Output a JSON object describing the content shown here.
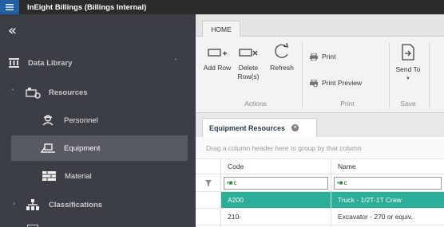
{
  "app": {
    "title": "InEight Billings  (Billings Internal)",
    "colors": {
      "titlebar": "#2b2b2b",
      "menu_button": "#1e5fa6",
      "sidebar": "#3b3e45",
      "selected_row": "#2bae98"
    }
  },
  "sidebar": {
    "collapse_icon": "double-chevron-left-icon",
    "items": [
      {
        "label": "Data Library",
        "icon": "library-icon",
        "expanded": true
      },
      {
        "label": "Resources",
        "icon": "resources-icon",
        "expanded": true
      },
      {
        "label": "Personnel",
        "icon": "personnel-icon"
      },
      {
        "label": "Equipment",
        "icon": "equipment-icon",
        "selected": true
      },
      {
        "label": "Material",
        "icon": "material-icon"
      },
      {
        "label": "Classifications",
        "icon": "hierarchy-icon",
        "expanded": false
      }
    ]
  },
  "ribbon": {
    "tab": "HOME",
    "buttons": {
      "add_row": "Add Row",
      "delete_row_1": "Delete",
      "delete_row_2": "Row(s)",
      "refresh": "Refresh",
      "print": "Print",
      "print_preview": "Print Preview",
      "send_to": "Send To"
    },
    "groups": {
      "actions": "Actions",
      "print": "Print",
      "save": "Save"
    }
  },
  "document": {
    "tab_label": "Equipment Resources",
    "group_hint": "Drag a column header here to group by that column"
  },
  "grid": {
    "columns": [
      "Code",
      "Name"
    ],
    "filter_placeholder": "c",
    "rows": [
      {
        "code": "A200",
        "name": "Truck - 1/2T-1T Crew",
        "selected": true
      },
      {
        "code": "210-",
        "name": "Excavator - 270 or equiv."
      }
    ]
  }
}
